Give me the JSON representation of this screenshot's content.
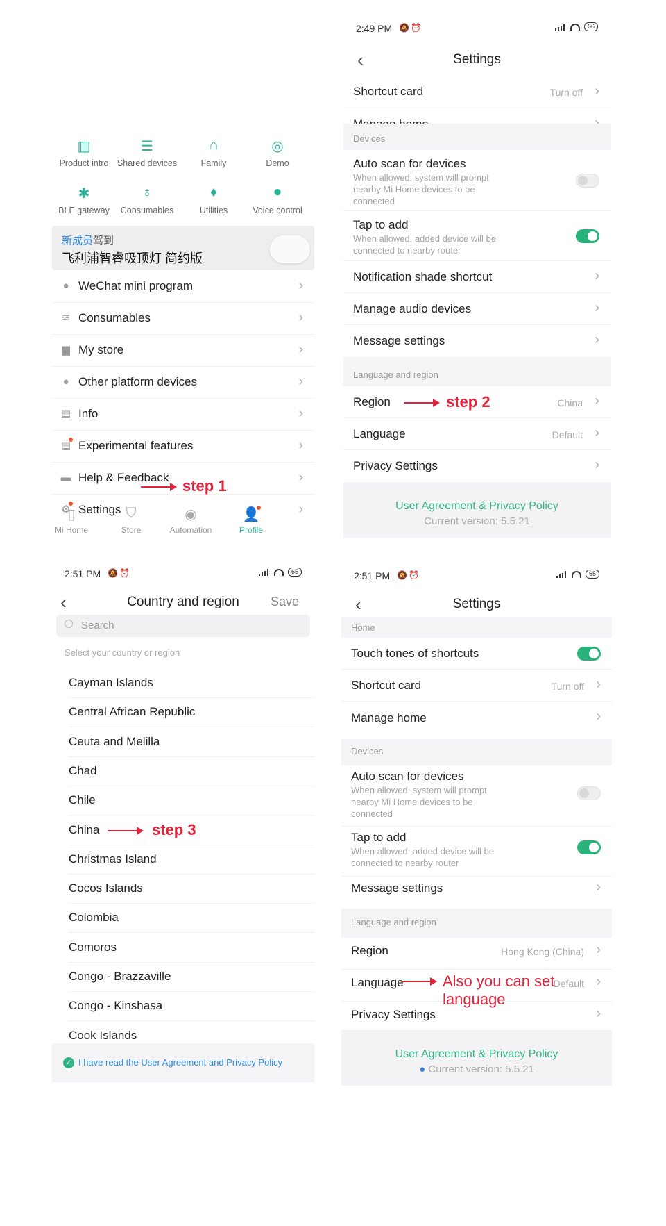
{
  "panel1": {
    "grid": [
      {
        "icon": "book-icon",
        "label": "Product intro"
      },
      {
        "icon": "shared-devices-icon",
        "label": "Shared devices"
      },
      {
        "icon": "home-icon",
        "label": "Family"
      },
      {
        "icon": "demo-icon",
        "label": "Demo"
      },
      {
        "icon": "bluetooth-icon",
        "label": "BLE gateway"
      },
      {
        "icon": "bulb-icon",
        "label": "Consumables"
      },
      {
        "icon": "drop-icon",
        "label": "Utilities"
      },
      {
        "icon": "mic-icon",
        "label": "Voice control"
      }
    ],
    "banner": {
      "line1_highlight": "新成员",
      "line1_rest": "驾到",
      "line2": "飞利浦智睿吸顶灯 简约版"
    },
    "menu": [
      {
        "icon": "wechat-icon",
        "label": "WeChat mini program"
      },
      {
        "icon": "layers-icon",
        "label": "Consumables"
      },
      {
        "icon": "bag-icon",
        "label": "My store"
      },
      {
        "icon": "more-icon",
        "label": "Other platform devices"
      },
      {
        "icon": "info-icon",
        "label": "Info"
      },
      {
        "icon": "experiment-icon",
        "label": "Experimental features"
      },
      {
        "icon": "feedback-icon",
        "label": "Help & Feedback"
      },
      {
        "icon": "gear-icon",
        "label": "Settings"
      }
    ],
    "step_label": "step 1",
    "tabs": [
      {
        "icon": "door-icon",
        "label": "Mi Home"
      },
      {
        "icon": "store-icon",
        "label": "Store"
      },
      {
        "icon": "automation-icon",
        "label": "Automation"
      },
      {
        "icon": "profile-icon",
        "label": "Profile"
      }
    ],
    "accent": "#2bb39a",
    "notify_color": "#f0562d"
  },
  "panel2": {
    "status_time": "2:49 PM",
    "battery": "66",
    "title": "Settings",
    "rows": {
      "shortcut_card": "Shortcut card",
      "shortcut_card_value": "Turn off",
      "manage_home": "Manage home",
      "section_devices": "Devices",
      "auto_scan": "Auto scan for devices",
      "auto_scan_sub": "When allowed, system will prompt nearby Mi Home devices to be connected",
      "tap_to_add": "Tap to add",
      "tap_to_add_sub": "When allowed, added device will be connected to nearby router",
      "notification_shade": "Notification shade shortcut",
      "manage_audio": "Manage audio devices",
      "message_settings": "Message settings",
      "section_language": "Language and region",
      "region": "Region",
      "region_value": "China",
      "language": "Language",
      "language_value": "Default",
      "privacy": "Privacy Settings"
    },
    "step_label": "step 2",
    "footer_link": "User Agreement & Privacy Policy",
    "footer_version": "Current version: 5.5.21"
  },
  "panel3": {
    "status_time": "2:51 PM",
    "battery": "65",
    "title": "Country and region",
    "save": "Save",
    "search_placeholder": "Search",
    "hint": "Select your country or region",
    "countries": [
      "Cayman Islands",
      "Central African Republic",
      "Ceuta and Melilla",
      "Chad",
      "Chile",
      "China",
      "Christmas Island",
      "Cocos Islands",
      "Colombia",
      "Comoros",
      "Congo - Brazzaville",
      "Congo - Kinshasa",
      "Cook Islands"
    ],
    "step_label": "step 3",
    "agree_text": "I have read the User Agreement and Privacy Policy"
  },
  "panel4": {
    "status_time": "2:51 PM",
    "battery": "65",
    "title": "Settings",
    "rows": {
      "section_home": "Home",
      "touch_tones": "Touch tones of shortcuts",
      "shortcut_card": "Shortcut card",
      "shortcut_card_value": "Turn off",
      "manage_home": "Manage home",
      "section_devices": "Devices",
      "auto_scan": "Auto scan for devices",
      "auto_scan_sub": "When allowed, system will prompt nearby Mi Home devices to be connected",
      "tap_to_add": "Tap to add",
      "tap_to_add_sub": "When allowed, added device will be connected to nearby router",
      "message_settings": "Message settings",
      "section_language": "Language and region",
      "region": "Region",
      "region_value": "Hong Kong (China)",
      "language": "Language",
      "language_value": "Default",
      "privacy": "Privacy Settings"
    },
    "annotation": "Also you can set language",
    "footer_link": "User Agreement & Privacy Policy",
    "footer_version": "Current version: 5.5.21"
  }
}
